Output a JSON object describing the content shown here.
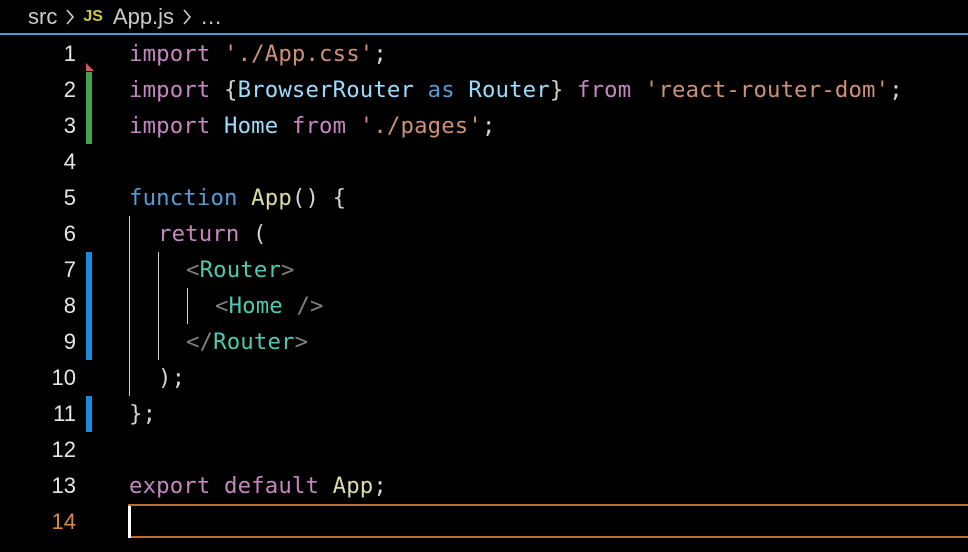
{
  "breadcrumb": {
    "folder": "src",
    "file_badge": "JS",
    "file": "App.js",
    "more": "…"
  },
  "editor": {
    "active_line": 14,
    "lines": [
      {
        "n": "1"
      },
      {
        "n": "2"
      },
      {
        "n": "3"
      },
      {
        "n": "4"
      },
      {
        "n": "5"
      },
      {
        "n": "6"
      },
      {
        "n": "7"
      },
      {
        "n": "8"
      },
      {
        "n": "9"
      },
      {
        "n": "10"
      },
      {
        "n": "11"
      },
      {
        "n": "12"
      },
      {
        "n": "13"
      },
      {
        "n": "14"
      }
    ],
    "tokens": {
      "l1": [
        "import",
        " ",
        "'./App.css'",
        ";"
      ],
      "l2": [
        "import",
        " {",
        "BrowserRouter",
        " ",
        "as",
        " ",
        "Router",
        "} ",
        "from",
        " ",
        "'react-router-dom'",
        ";"
      ],
      "l3": [
        "import",
        " ",
        "Home",
        " ",
        "from",
        " ",
        "'./pages'",
        ";"
      ],
      "l5": [
        "function",
        " ",
        "App",
        "() {"
      ],
      "l6": [
        "return",
        " ("
      ],
      "l7": [
        "<",
        "Router",
        ">"
      ],
      "l8": [
        "<",
        "Home",
        " />"
      ],
      "l9": [
        "</",
        "Router",
        ">"
      ],
      "l10": [
        ");"
      ],
      "l11": [
        "};"
      ],
      "l13": [
        "export",
        " ",
        "default",
        " ",
        "App",
        ";"
      ]
    }
  },
  "colors": {
    "keyword": "#c586c0",
    "storage": "#569cd6",
    "string": "#ce9178",
    "identifier": "#9cdcfe",
    "function": "#dcdcaa",
    "tag": "#4ec9b0",
    "added_gutter": "#3fa34d",
    "modified_gutter": "#1b8ad8",
    "active_line_number": "#d98a3a"
  }
}
